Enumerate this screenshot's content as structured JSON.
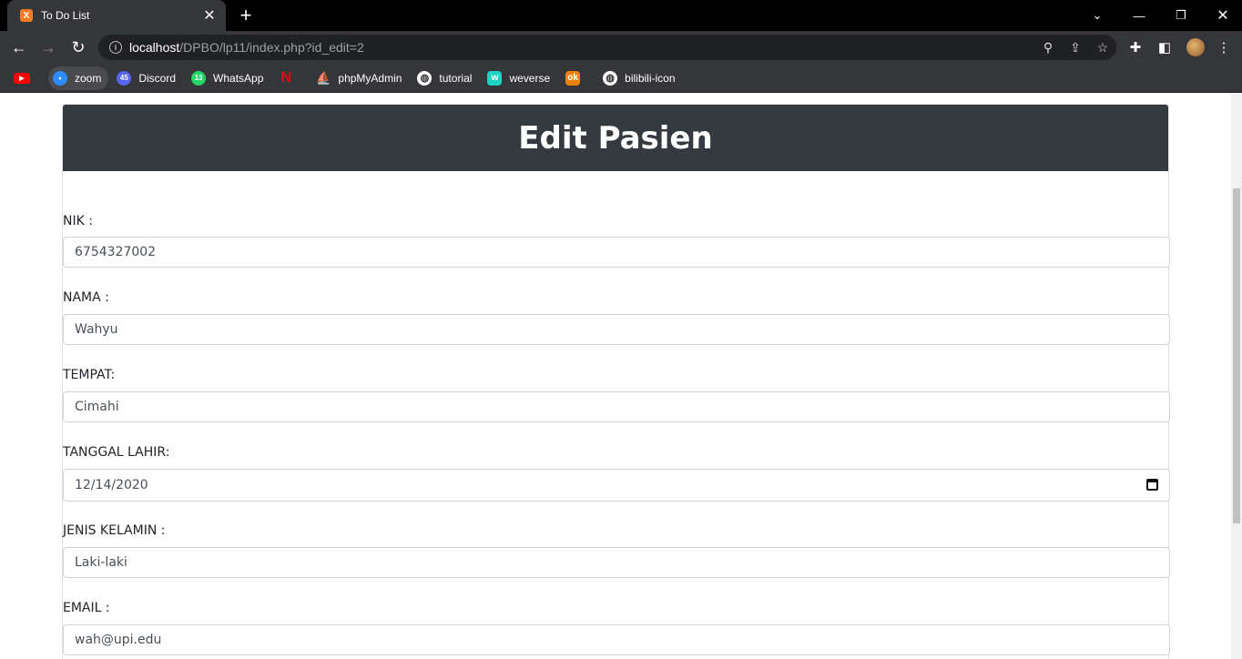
{
  "browser": {
    "tab_title": "To Do List",
    "tab_favicon_letter": "X",
    "url_host": "localhost",
    "url_path": "/DPBO/lp11/index.php?id_edit=2",
    "bookmarks": [
      {
        "label": "",
        "icon": "youtube-icon",
        "color": "#ff0000"
      },
      {
        "label": "zoom",
        "icon": "zoom-icon",
        "color": "#2d8cff"
      },
      {
        "label": "Discord",
        "icon": "discord-icon",
        "color": "#5865f2",
        "badge": "45"
      },
      {
        "label": "WhatsApp",
        "icon": "whatsapp-icon",
        "color": "#25d366",
        "badge": "13"
      },
      {
        "label": "",
        "icon": "netflix-icon",
        "color": "#e50914"
      },
      {
        "label": "phpMyAdmin",
        "icon": "phpmyadmin-icon",
        "color": "#f29111"
      },
      {
        "label": "tutorial",
        "icon": "globe-icon",
        "color": "#ffffff"
      },
      {
        "label": "weverse",
        "icon": "weverse-icon",
        "color": "#1ed3c1"
      },
      {
        "label": "",
        "icon": "odnoklassniki-icon",
        "color": "#ee8208"
      },
      {
        "label": "bilibili-icon",
        "icon": "globe-icon",
        "color": "#ffffff"
      }
    ]
  },
  "page": {
    "title": "Edit Pasien",
    "fields": [
      {
        "label": "NIK :",
        "value": "6754327002"
      },
      {
        "label": "NAMA :",
        "value": "Wahyu"
      },
      {
        "label": "TEMPAT:",
        "value": "Cimahi"
      },
      {
        "label": "TANGGAL LAHIR:",
        "value": "12/14/2020"
      },
      {
        "label": "JENIS KELAMIN :",
        "value": "Laki-laki"
      },
      {
        "label": "EMAIL :",
        "value": "wah@upi.edu"
      }
    ]
  }
}
